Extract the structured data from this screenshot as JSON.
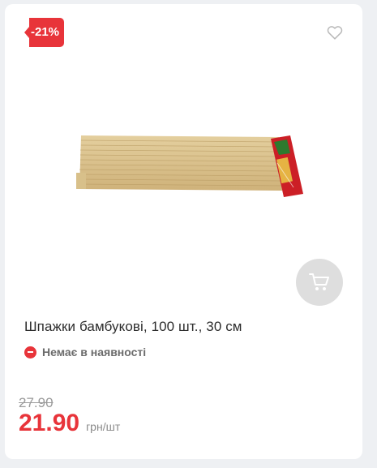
{
  "badge": {
    "discount": "-21%",
    "color": "#e8343a"
  },
  "icons": {
    "wishlist": "heart-outline-icon",
    "cart": "shopping-cart-icon"
  },
  "product": {
    "title": "Шпажки бамбукові, 100 шт., 30 см",
    "availability": "Немає в наявності",
    "old_price": "27.90",
    "price": "21.90",
    "unit": "грн/шт"
  }
}
